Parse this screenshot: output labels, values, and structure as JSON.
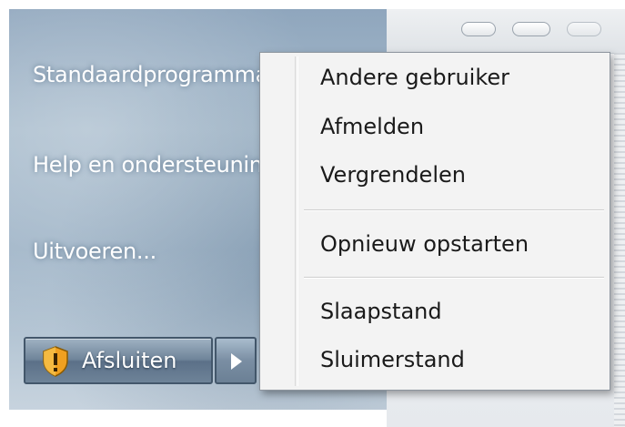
{
  "start_menu": {
    "items": [
      {
        "label": "Standaardprogramma's"
      },
      {
        "label": "Help en ondersteuning"
      },
      {
        "label": "Uitvoeren..."
      }
    ],
    "shutdown": {
      "label": "Afsluiten",
      "icon": "shield-icon",
      "arrow_icon": "arrow-right-icon"
    }
  },
  "context_menu": {
    "items": [
      {
        "label": "Andere gebruiker"
      },
      {
        "label": "Afmelden"
      },
      {
        "label": "Vergrendelen"
      },
      {
        "label": "Opnieuw opstarten"
      },
      {
        "label": "Slaapstand"
      },
      {
        "label": "Sluimerstand"
      }
    ]
  },
  "colors": {
    "panel": "#9fb4c7",
    "menu_background": "#f3f3f3",
    "shield_orange": "#f0a020"
  }
}
